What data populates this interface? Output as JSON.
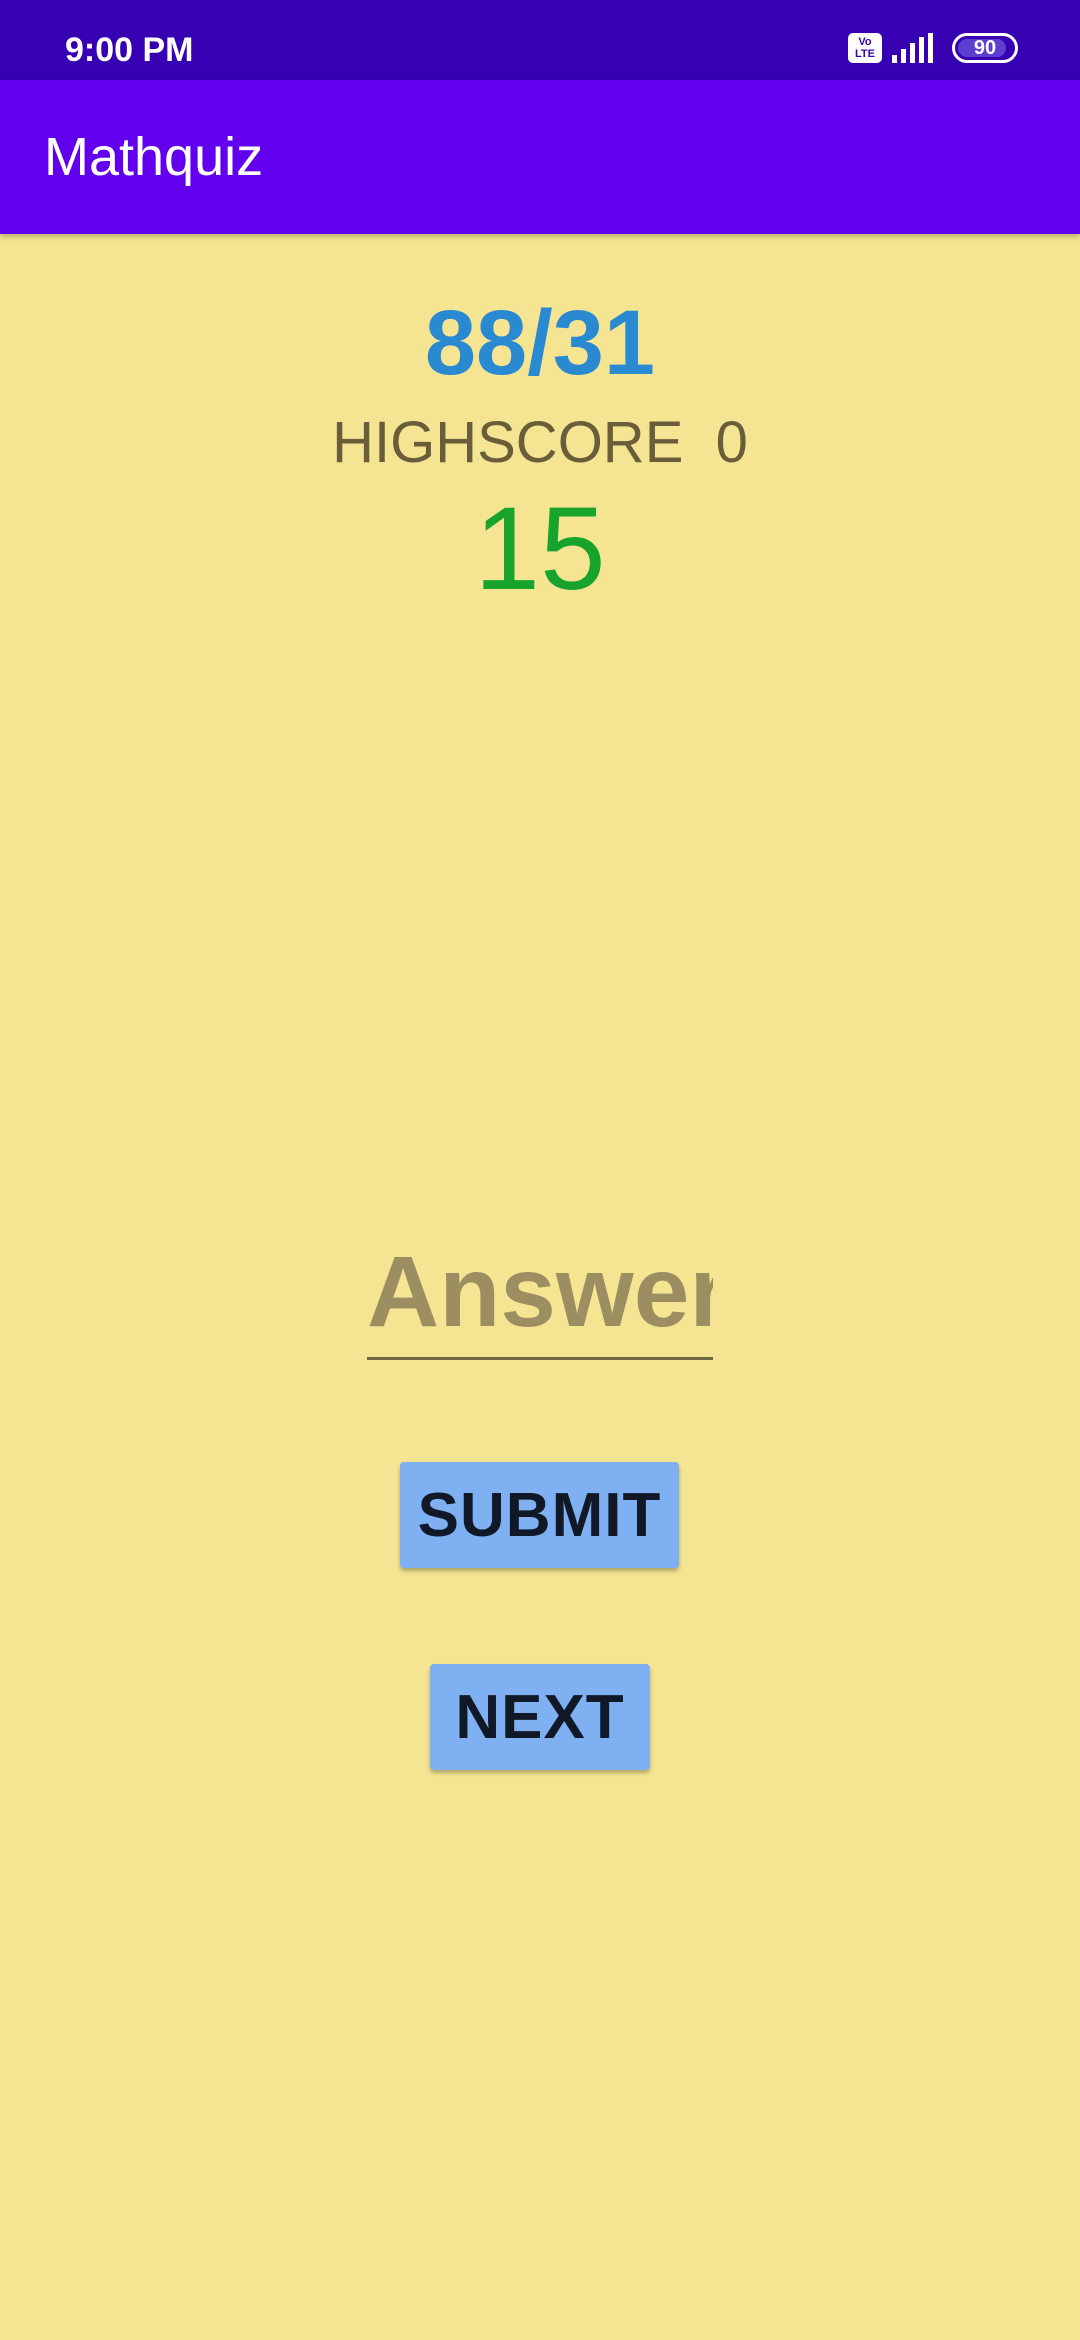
{
  "status_bar": {
    "time": "9:00 PM",
    "network_badge": "Vo\nLTE",
    "battery_level": "90",
    "icons": [
      "volte-icon",
      "signal-icon",
      "battery-icon"
    ],
    "background_color": "#3700b3"
  },
  "app_bar": {
    "title": "Mathquiz",
    "background_color": "#6200ee"
  },
  "quiz": {
    "question": "88/31",
    "highscore_label": "HIGHSCORE  0",
    "timer": "15",
    "question_color": "#2a8ad1",
    "timer_color": "#17a32c"
  },
  "answer": {
    "placeholder": "Answer",
    "value": ""
  },
  "buttons": {
    "submit_label": "SUBMIT",
    "next_label": "NEXT",
    "color": "#7fb0f2"
  },
  "theme": {
    "background_color": "#f5e592"
  }
}
